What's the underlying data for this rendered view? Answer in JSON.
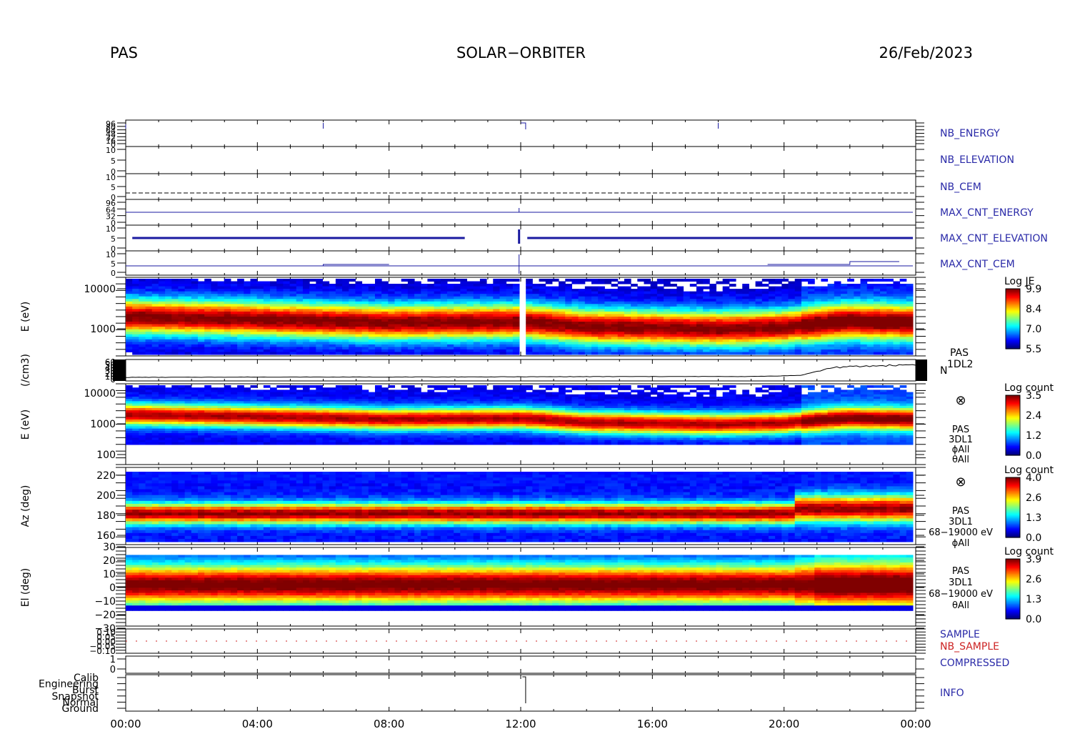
{
  "header": {
    "instrument": "PAS",
    "mission": "SOLAR−ORBITER",
    "date": "26/Feb/2023"
  },
  "colors": {
    "hk_trace": "#1a1aa0",
    "hk_label": "#2a2aa8",
    "nb_sample": "#cc2222",
    "density_trace": "#000000"
  },
  "chart_data": {
    "type": "heatmap",
    "time_axis": {
      "ticks": [
        "00:00",
        "04:00",
        "08:00",
        "12:00",
        "16:00",
        "20:00",
        "00:00"
      ],
      "range_hours": [
        0,
        24
      ]
    },
    "housekeeping": [
      {
        "label": "NB_ENERGY",
        "ticks": [
          "96",
          "80",
          "64",
          "48",
          "32",
          "16",
          "0"
        ]
      },
      {
        "label": "NB_ELEVATION",
        "ticks": [
          "10",
          "5",
          "0"
        ]
      },
      {
        "label": "NB_CEM",
        "ticks": [
          "10",
          "5",
          "0"
        ]
      },
      {
        "label": "MAX_CNT_ENERGY",
        "ticks": [
          "96",
          "64",
          "32",
          "0"
        ]
      },
      {
        "label": "MAX_CNT_ELEVATION",
        "ticks": [
          "10",
          "5",
          "0"
        ]
      },
      {
        "label": "MAX_CNT_CEM",
        "ticks": [
          "10",
          "5",
          "0"
        ]
      }
    ],
    "energy_1dl2": {
      "ylabel": "E (eV)",
      "yticks": [
        "10000",
        "1000"
      ],
      "colorbar": {
        "title": "Log JE",
        "ticks": [
          "9.9",
          "8.4",
          "7.0",
          "5.5"
        ]
      },
      "peak_energy_eV_by_hour": [
        [
          0,
          2000
        ],
        [
          4,
          1700
        ],
        [
          8,
          1400
        ],
        [
          12,
          1500
        ],
        [
          14,
          1100
        ],
        [
          18,
          950
        ],
        [
          20,
          1050
        ],
        [
          22,
          1500
        ],
        [
          24,
          1400
        ]
      ]
    },
    "density": {
      "ylabel": "(/cm3)",
      "yticks": [
        "60",
        "50",
        "40",
        "30",
        "20",
        "10",
        "0"
      ],
      "name_lines": [
        "PAS",
        "1DL2"
      ],
      "series_label": "N",
      "values_by_hour": [
        [
          0,
          5
        ],
        [
          4,
          6
        ],
        [
          8,
          6
        ],
        [
          12,
          7
        ],
        [
          16,
          8
        ],
        [
          19,
          8
        ],
        [
          20.5,
          12
        ],
        [
          21.5,
          40
        ],
        [
          24,
          50
        ]
      ]
    },
    "energy_3dl1": {
      "ylabel": "E (eV)",
      "yticks": [
        "10000",
        "1000",
        "100"
      ],
      "colorbar": {
        "title": "Log count",
        "ticks": [
          "3.5",
          "2.4",
          "1.2",
          "0.0"
        ]
      },
      "side_symbol": "⊗",
      "side_lines": [
        "PAS",
        "3DL1",
        "ϕAll",
        "θAll"
      ]
    },
    "azimuth": {
      "ylabel": "Az (deg)",
      "yticks": [
        "220",
        "200",
        "180",
        "160"
      ],
      "colorbar": {
        "title": "Log count",
        "ticks": [
          "4.0",
          "2.6",
          "1.3",
          "0.0"
        ]
      },
      "side_symbol": "⊗",
      "side_lines": [
        "PAS",
        "3DL1",
        "68−19000 eV",
        "ϕAll"
      ]
    },
    "elevation": {
      "ylabel": "El (deg)",
      "yticks": [
        "30",
        "20",
        "10",
        "0",
        "−10",
        "−20",
        "−30"
      ],
      "colorbar": {
        "title": "Log count",
        "ticks": [
          "3.9",
          "2.6",
          "1.3",
          "0.0"
        ]
      },
      "side_lines": [
        "PAS",
        "3DL1",
        "68−19000 eV",
        "θAll"
      ]
    },
    "sample": {
      "labels": [
        "SAMPLE",
        "NB_SAMPLE"
      ],
      "yticks": [
        "0.10",
        "0.05",
        "0.00",
        "−0.05",
        "−0.10"
      ]
    },
    "compressed": {
      "label": "COMPRESSED",
      "yticks": [
        "1",
        "0"
      ]
    },
    "info": {
      "label": "INFO",
      "yticks": [
        "Calib",
        "Engineering",
        "Burst",
        "Snapshot",
        "Normal",
        "Ground"
      ]
    }
  }
}
